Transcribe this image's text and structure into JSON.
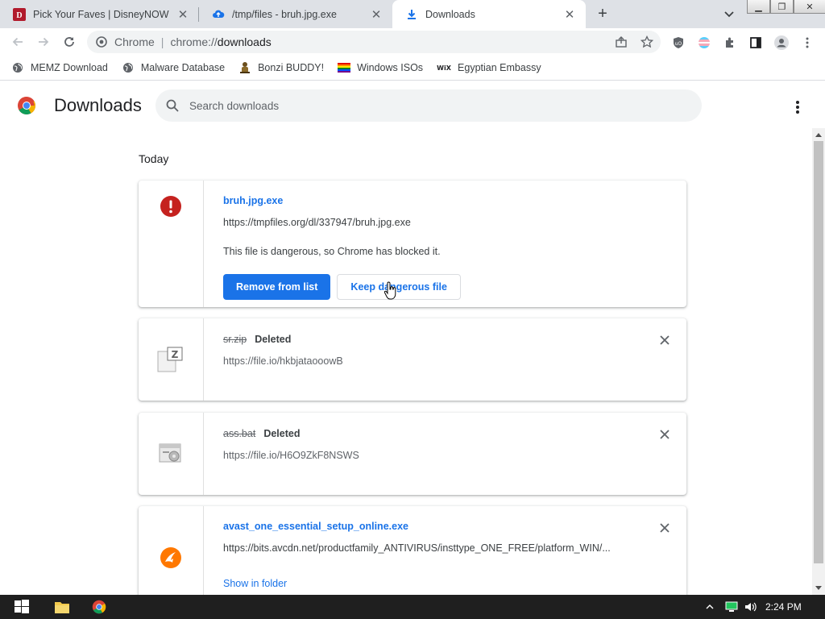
{
  "tabs": [
    {
      "title": "Pick Your Faves | DisneyNOW",
      "icon": "disneynow-icon"
    },
    {
      "title": "/tmp/files - bruh.jpg.exe",
      "icon": "cloud-upload-icon"
    },
    {
      "title": "Downloads",
      "icon": "download-icon",
      "active": true
    }
  ],
  "omnibox": {
    "scheme_label": "Chrome",
    "url_prefix": "chrome://",
    "url_host": "downloads"
  },
  "bookmarks": [
    {
      "label": "MEMZ Download",
      "icon": "globe-icon"
    },
    {
      "label": "Malware Database",
      "icon": "globe-icon"
    },
    {
      "label": "Bonzi BUDDY!",
      "icon": "bonzi-icon"
    },
    {
      "label": "Windows ISOs",
      "icon": "rainbow-flag-icon"
    },
    {
      "label": "Egyptian Embassy",
      "icon": "wix-icon"
    }
  ],
  "page": {
    "title": "Downloads",
    "search_placeholder": "Search downloads"
  },
  "section_label": "Today",
  "downloads": [
    {
      "name": "bruh.jpg.exe",
      "url": "https://tmpfiles.org/dl/337947/bruh.jpg.exe",
      "warning": "This file is dangerous, so Chrome has blocked it.",
      "primary_button": "Remove from list",
      "secondary_button": "Keep dangerous file"
    },
    {
      "name": "sr.zip",
      "status": "Deleted",
      "url": "https://file.io/hkbjataooowB"
    },
    {
      "name": "ass.bat",
      "status": "Deleted",
      "url": "https://file.io/H6O9ZkF8NSWS"
    },
    {
      "name": "avast_one_essential_setup_online.exe",
      "url": "https://bits.avcdn.net/productfamily_ANTIVIRUS/insttype_ONE_FREE/platform_WIN/...",
      "link": "Show in folder"
    }
  ],
  "taskbar": {
    "clock": "2:24 PM"
  },
  "colors": {
    "accent": "#1a73e8",
    "danger": "#c5221f",
    "avast_orange": "#ff7800"
  }
}
